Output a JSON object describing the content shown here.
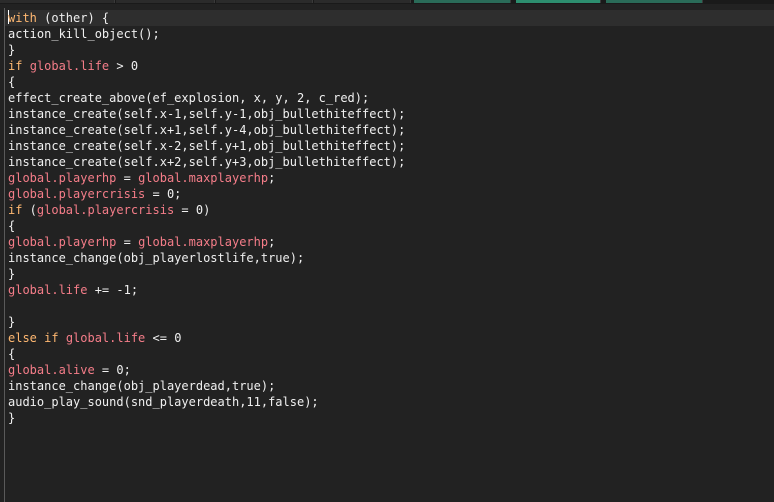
{
  "tabs": [
    "",
    "",
    "",
    "",
    "",
    "",
    ""
  ],
  "code_lines": [
    [
      {
        "t": "with",
        "c": "kw"
      },
      {
        "t": " (other) {",
        "c": "pl"
      }
    ],
    [
      {
        "t": "action_kill_object();",
        "c": "pl"
      }
    ],
    [
      {
        "t": "}",
        "c": "pl"
      }
    ],
    [
      {
        "t": "if",
        "c": "kw"
      },
      {
        "t": " ",
        "c": "pl"
      },
      {
        "t": "global.life",
        "c": "gv"
      },
      {
        "t": " > 0",
        "c": "pl"
      }
    ],
    [
      {
        "t": "{",
        "c": "pl"
      }
    ],
    [
      {
        "t": "effect_create_above(ef_explosion, x, y, 2, c_red);",
        "c": "pl"
      }
    ],
    [
      {
        "t": "instance_create(self.x-1,self.y-1,obj_bullethiteffect);",
        "c": "pl"
      }
    ],
    [
      {
        "t": "instance_create(self.x+1,self.y-4,obj_bullethiteffect);",
        "c": "pl"
      }
    ],
    [
      {
        "t": "instance_create(self.x-2,self.y+1,obj_bullethiteffect);",
        "c": "pl"
      }
    ],
    [
      {
        "t": "instance_create(self.x+2,self.y+3,obj_bullethiteffect);",
        "c": "pl"
      }
    ],
    [
      {
        "t": "global.playerhp",
        "c": "gv"
      },
      {
        "t": " = ",
        "c": "pl"
      },
      {
        "t": "global.maxplayerhp",
        "c": "gv"
      },
      {
        "t": ";",
        "c": "pl"
      }
    ],
    [
      {
        "t": "global.playercrisis",
        "c": "gv"
      },
      {
        "t": " = 0;",
        "c": "pl"
      }
    ],
    [
      {
        "t": "if",
        "c": "kw"
      },
      {
        "t": " (",
        "c": "pl"
      },
      {
        "t": "global.playercrisis",
        "c": "gv"
      },
      {
        "t": " = 0)",
        "c": "pl"
      }
    ],
    [
      {
        "t": "{",
        "c": "pl"
      }
    ],
    [
      {
        "t": "global.playerhp",
        "c": "gv"
      },
      {
        "t": " = ",
        "c": "pl"
      },
      {
        "t": "global.maxplayerhp",
        "c": "gv"
      },
      {
        "t": ";",
        "c": "pl"
      }
    ],
    [
      {
        "t": "instance_change(obj_playerlostlife,true);",
        "c": "pl"
      }
    ],
    [
      {
        "t": "}",
        "c": "pl"
      }
    ],
    [
      {
        "t": "global.life",
        "c": "gv"
      },
      {
        "t": " += -1;",
        "c": "pl"
      }
    ],
    [
      {
        "t": "",
        "c": "pl"
      }
    ],
    [
      {
        "t": "}",
        "c": "pl"
      }
    ],
    [
      {
        "t": "else if",
        "c": "kw"
      },
      {
        "t": " ",
        "c": "pl"
      },
      {
        "t": "global.life",
        "c": "gv"
      },
      {
        "t": " <= 0",
        "c": "pl"
      }
    ],
    [
      {
        "t": "{",
        "c": "pl"
      }
    ],
    [
      {
        "t": "global.alive",
        "c": "gv"
      },
      {
        "t": " = 0;",
        "c": "pl"
      }
    ],
    [
      {
        "t": "instance_change(obj_playerdead,true);",
        "c": "pl"
      }
    ],
    [
      {
        "t": "audio_play_sound(snd_playerdeath,11,false);",
        "c": "pl"
      }
    ],
    [
      {
        "t": "}",
        "c": "pl"
      }
    ]
  ],
  "colors": {
    "background": "#222222",
    "keyword": "#ffb871",
    "global_variable": "#f57d89",
    "plain": "#f0f0f0",
    "active_tab": "#2d8e6f"
  }
}
